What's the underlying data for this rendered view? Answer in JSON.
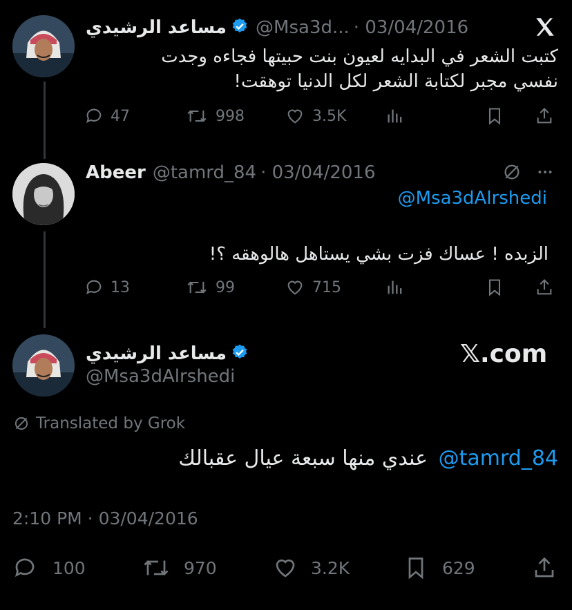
{
  "tweets": [
    {
      "name": "مساعد الرشيدي",
      "handle": "@Msa3d...",
      "date": "· 03/04/2016",
      "text_lines": [
        "كتبت الشعر في البدايه  لعيون  بنت حبيتها  فجاءه  وجدت",
        "نفسي مجبر لكتابة الشعر لكل الدنيا توهقت!"
      ],
      "replies": "47",
      "retweets": "998",
      "likes": "3.5K"
    },
    {
      "name": "Abeer",
      "handle": "@tamrd_84",
      "date": "· 03/04/2016",
      "mention": "@Msa3dAlrshedi",
      "text": "الزبده ! عساك فزت بشي يستاهل هالوهقه  ؟!",
      "replies": "13",
      "retweets": "99",
      "likes": "715"
    }
  ],
  "main": {
    "name": "مساعد الرشيدي",
    "handle": "@Msa3dAlrshedi",
    "brand": "𝕏.com",
    "translated": "Translated by Grok",
    "mention": "@tamrd_84",
    "text": "عندي منها سبعة عيال عقبالك",
    "timestamp": "2:10 PM · 03/04/2016",
    "replies": "100",
    "retweets": "970",
    "likes": "3.2K",
    "bookmarks": "629"
  },
  "colors": {
    "background": "#000000",
    "text": "#e7e9ea",
    "muted": "#71767b",
    "link": "#1d9bf0",
    "verified": "#1d9bf0"
  },
  "icons": [
    "x-logo-icon",
    "verified-badge-icon",
    "reply-icon",
    "retweet-icon",
    "like-icon",
    "views-icon",
    "bookmark-icon",
    "share-icon",
    "grok-icon",
    "more-icon"
  ]
}
